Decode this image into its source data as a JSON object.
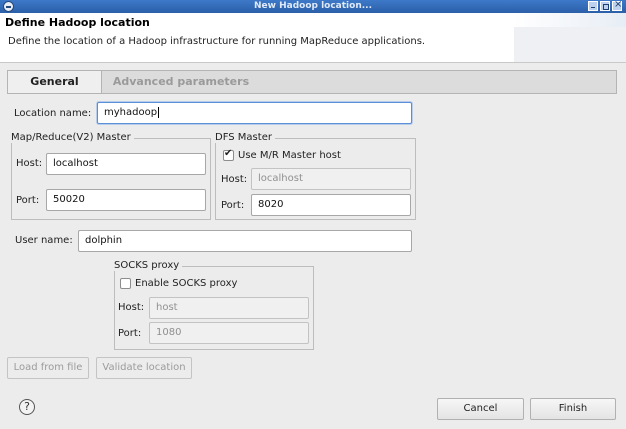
{
  "window": {
    "title": "New Hadoop location..."
  },
  "header": {
    "title": "Define Hadoop location",
    "description": "Define the location of a Hadoop infrastructure for running MapReduce applications."
  },
  "tabs": [
    {
      "label": "General",
      "selected": true
    },
    {
      "label": "Advanced parameters",
      "selected": false
    }
  ],
  "general": {
    "location_name_label": "Location name:",
    "location_name_value": "myhadoop",
    "mapreduce_master": {
      "title": "Map/Reduce(V2) Master",
      "host_label": "Host:",
      "host_value": "localhost",
      "port_label": "Port:",
      "port_value": "50020"
    },
    "dfs_master": {
      "title": "DFS Master",
      "use_mr_host_label": "Use M/R Master host",
      "use_mr_host_checked": true,
      "host_label": "Host:",
      "host_value": "localhost",
      "port_label": "Port:",
      "port_value": "8020"
    },
    "user_name_label": "User name:",
    "user_name_value": "dolphin",
    "socks_proxy": {
      "title": "SOCKS proxy",
      "enable_label": "Enable SOCKS proxy",
      "enable_checked": false,
      "host_label": "Host:",
      "host_value": "host",
      "port_label": "Port:",
      "port_value": "1080"
    }
  },
  "buttons": {
    "load_from_file": "Load from file",
    "validate_location": "Validate location",
    "cancel": "Cancel",
    "finish": "Finish"
  },
  "icons": {
    "help": "?"
  },
  "colors": {
    "titlebar": "#2b5fa8",
    "dialog_bg": "#ececec",
    "focus_border": "#5b8fd6"
  }
}
